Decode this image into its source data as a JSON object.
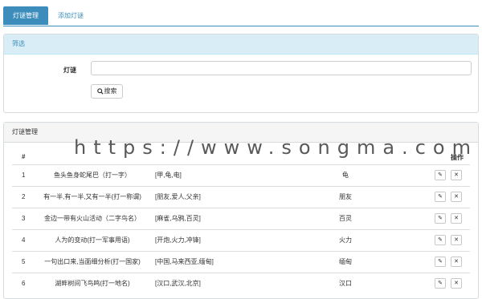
{
  "tabs": [
    {
      "label": "灯谜管理",
      "active": true
    },
    {
      "label": "添加灯谜",
      "active": false
    }
  ],
  "filter": {
    "title": "筛选",
    "field_label": "灯谜",
    "input_value": "",
    "search_label": "搜索"
  },
  "list": {
    "title": "灯谜管理",
    "columns": {
      "num": "#",
      "actions": "操作"
    },
    "rows": [
      {
        "num": "1",
        "riddle": "鱼头鱼身蛇尾巴（打一字）",
        "hint": "[甲,龟,电]",
        "answer": "龟"
      },
      {
        "num": "2",
        "riddle": "有一半,有一半,又有一半(打一称谓)",
        "hint": "[朋友,爱人,父亲]",
        "answer": "朋友"
      },
      {
        "num": "3",
        "riddle": "金边一带有火山活动（二字鸟名）",
        "hint": "[麻雀,乌鸦,百灵]",
        "answer": "百灵"
      },
      {
        "num": "4",
        "riddle": "人为的变动(打一军事用语)",
        "hint": "[开炮,火力,冲锋]",
        "answer": "火力"
      },
      {
        "num": "5",
        "riddle": "一句出口来,当面细分析(打一国家)",
        "hint": "[中国,马来西亚,缅甸]",
        "answer": "缅甸"
      },
      {
        "num": "6",
        "riddle": "湖畔树间飞鸟鸣(打一地名)",
        "hint": "[汉口,武汉,北京]",
        "answer": "汉口"
      }
    ]
  },
  "watermark": "https://www.songma.com",
  "icons": {
    "edit": "edit-icon",
    "delete": "close-icon",
    "search": "search-icon"
  },
  "colors": {
    "accent": "#3c8dbc",
    "filter_heading_bg": "#d9edf7",
    "list_heading_bg": "#f5f5f5"
  }
}
